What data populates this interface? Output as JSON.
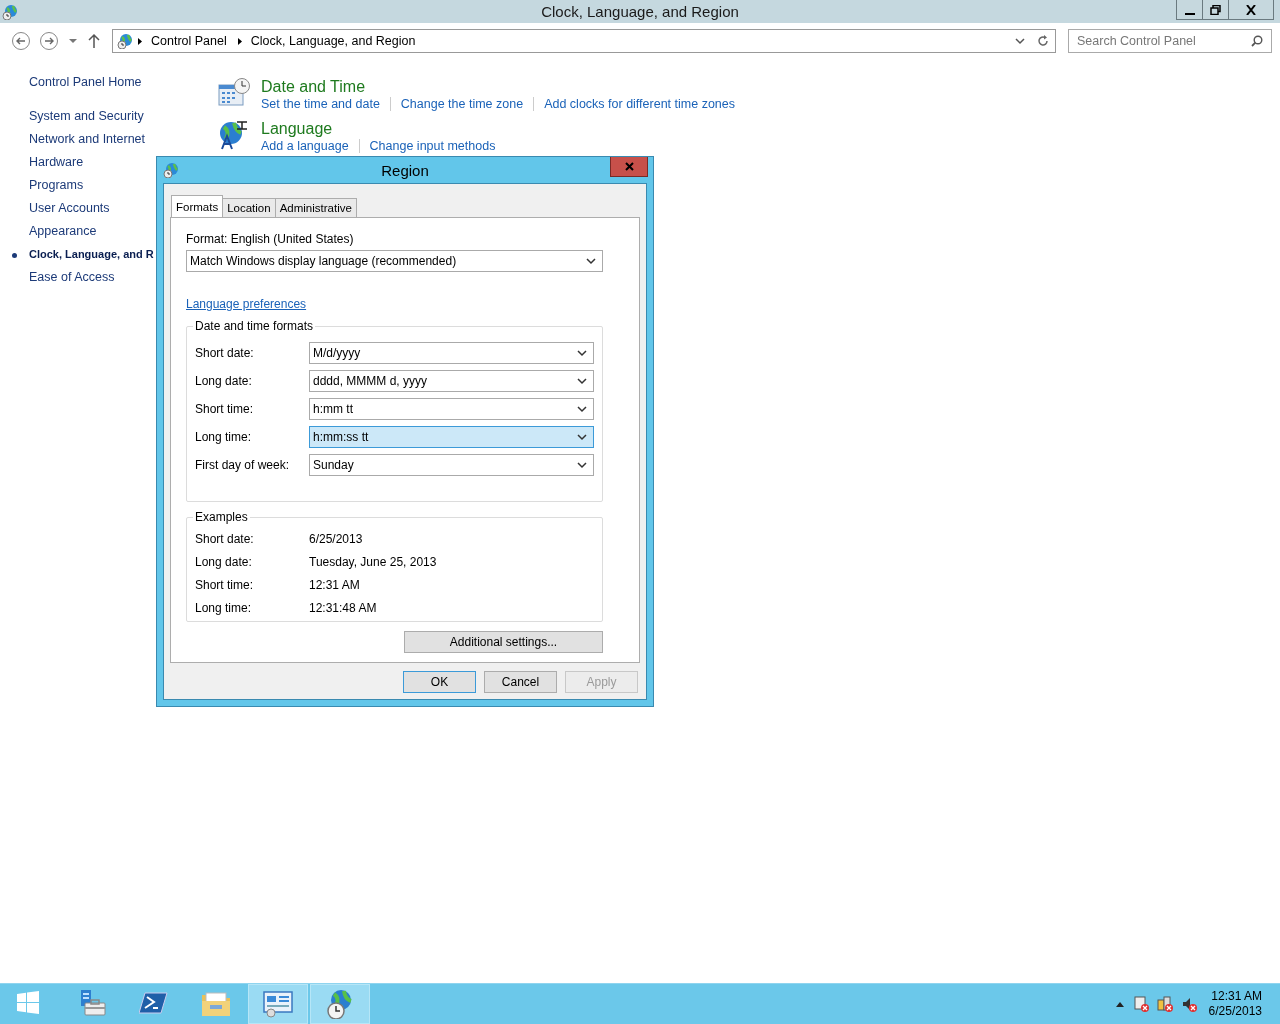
{
  "window": {
    "title": "Clock, Language, and Region"
  },
  "address_bar": {
    "path": [
      "Control Panel",
      "Clock, Language, and Region"
    ]
  },
  "search": {
    "placeholder": "Search Control Panel"
  },
  "sidebar": {
    "home": "Control Panel Home",
    "items": [
      {
        "label": "System and Security",
        "selected": false
      },
      {
        "label": "Network and Internet",
        "selected": false
      },
      {
        "label": "Hardware",
        "selected": false
      },
      {
        "label": "Programs",
        "selected": false
      },
      {
        "label": "User Accounts",
        "selected": false
      },
      {
        "label": "Appearance",
        "selected": false
      },
      {
        "label": "Clock, Language, and R",
        "selected": true
      },
      {
        "label": "Ease of Access",
        "selected": false
      }
    ]
  },
  "categories": [
    {
      "kind": "clock",
      "title": "Date and Time",
      "links": [
        "Set the time and date",
        "Change the time zone",
        "Add clocks for different time zones"
      ]
    },
    {
      "kind": "language",
      "title": "Language",
      "links": [
        "Add a language",
        "Change input methods"
      ]
    }
  ],
  "dialog": {
    "title": "Region",
    "tabs": [
      {
        "label": "Formats",
        "selected": true
      },
      {
        "label": "Location",
        "selected": false
      },
      {
        "label": "Administrative",
        "selected": false
      }
    ],
    "format_label": "Format: English (United States)",
    "format_value": "Match Windows display language (recommended)",
    "language_link": "Language preferences",
    "formats_group": {
      "title": "Date and time formats",
      "rows": [
        {
          "label": "Short date:",
          "value": "M/d/yyyy",
          "selected": false
        },
        {
          "label": "Long date:",
          "value": "dddd, MMMM d, yyyy",
          "selected": false
        },
        {
          "label": "Short time:",
          "value": "h:mm tt",
          "selected": false
        },
        {
          "label": "Long time:",
          "value": "h:mm:ss tt",
          "selected": true
        },
        {
          "label": "First day of week:",
          "value": "Sunday",
          "selected": false
        }
      ]
    },
    "examples_group": {
      "title": "Examples",
      "rows": [
        {
          "label": "Short date:",
          "value": "6/25/2013"
        },
        {
          "label": "Long date:",
          "value": "Tuesday, June 25, 2013"
        },
        {
          "label": "Short time:",
          "value": "12:31 AM"
        },
        {
          "label": "Long time:",
          "value": "12:31:48 AM"
        }
      ]
    },
    "additional_button": "Additional settings...",
    "buttons": [
      {
        "label": "OK",
        "disabled": false
      },
      {
        "label": "Cancel",
        "disabled": false
      },
      {
        "label": "Apply",
        "disabled": true
      }
    ]
  },
  "taskbar": {
    "items": [
      {
        "kind": "start",
        "selected": false
      },
      {
        "kind": "server",
        "selected": false
      },
      {
        "kind": "shell",
        "selected": false
      },
      {
        "kind": "folder",
        "selected": false
      },
      {
        "kind": "panel",
        "selected": true
      },
      {
        "kind": "globe",
        "selected": true
      }
    ],
    "time": "12:31 AM",
    "date": "6/25/2013"
  }
}
